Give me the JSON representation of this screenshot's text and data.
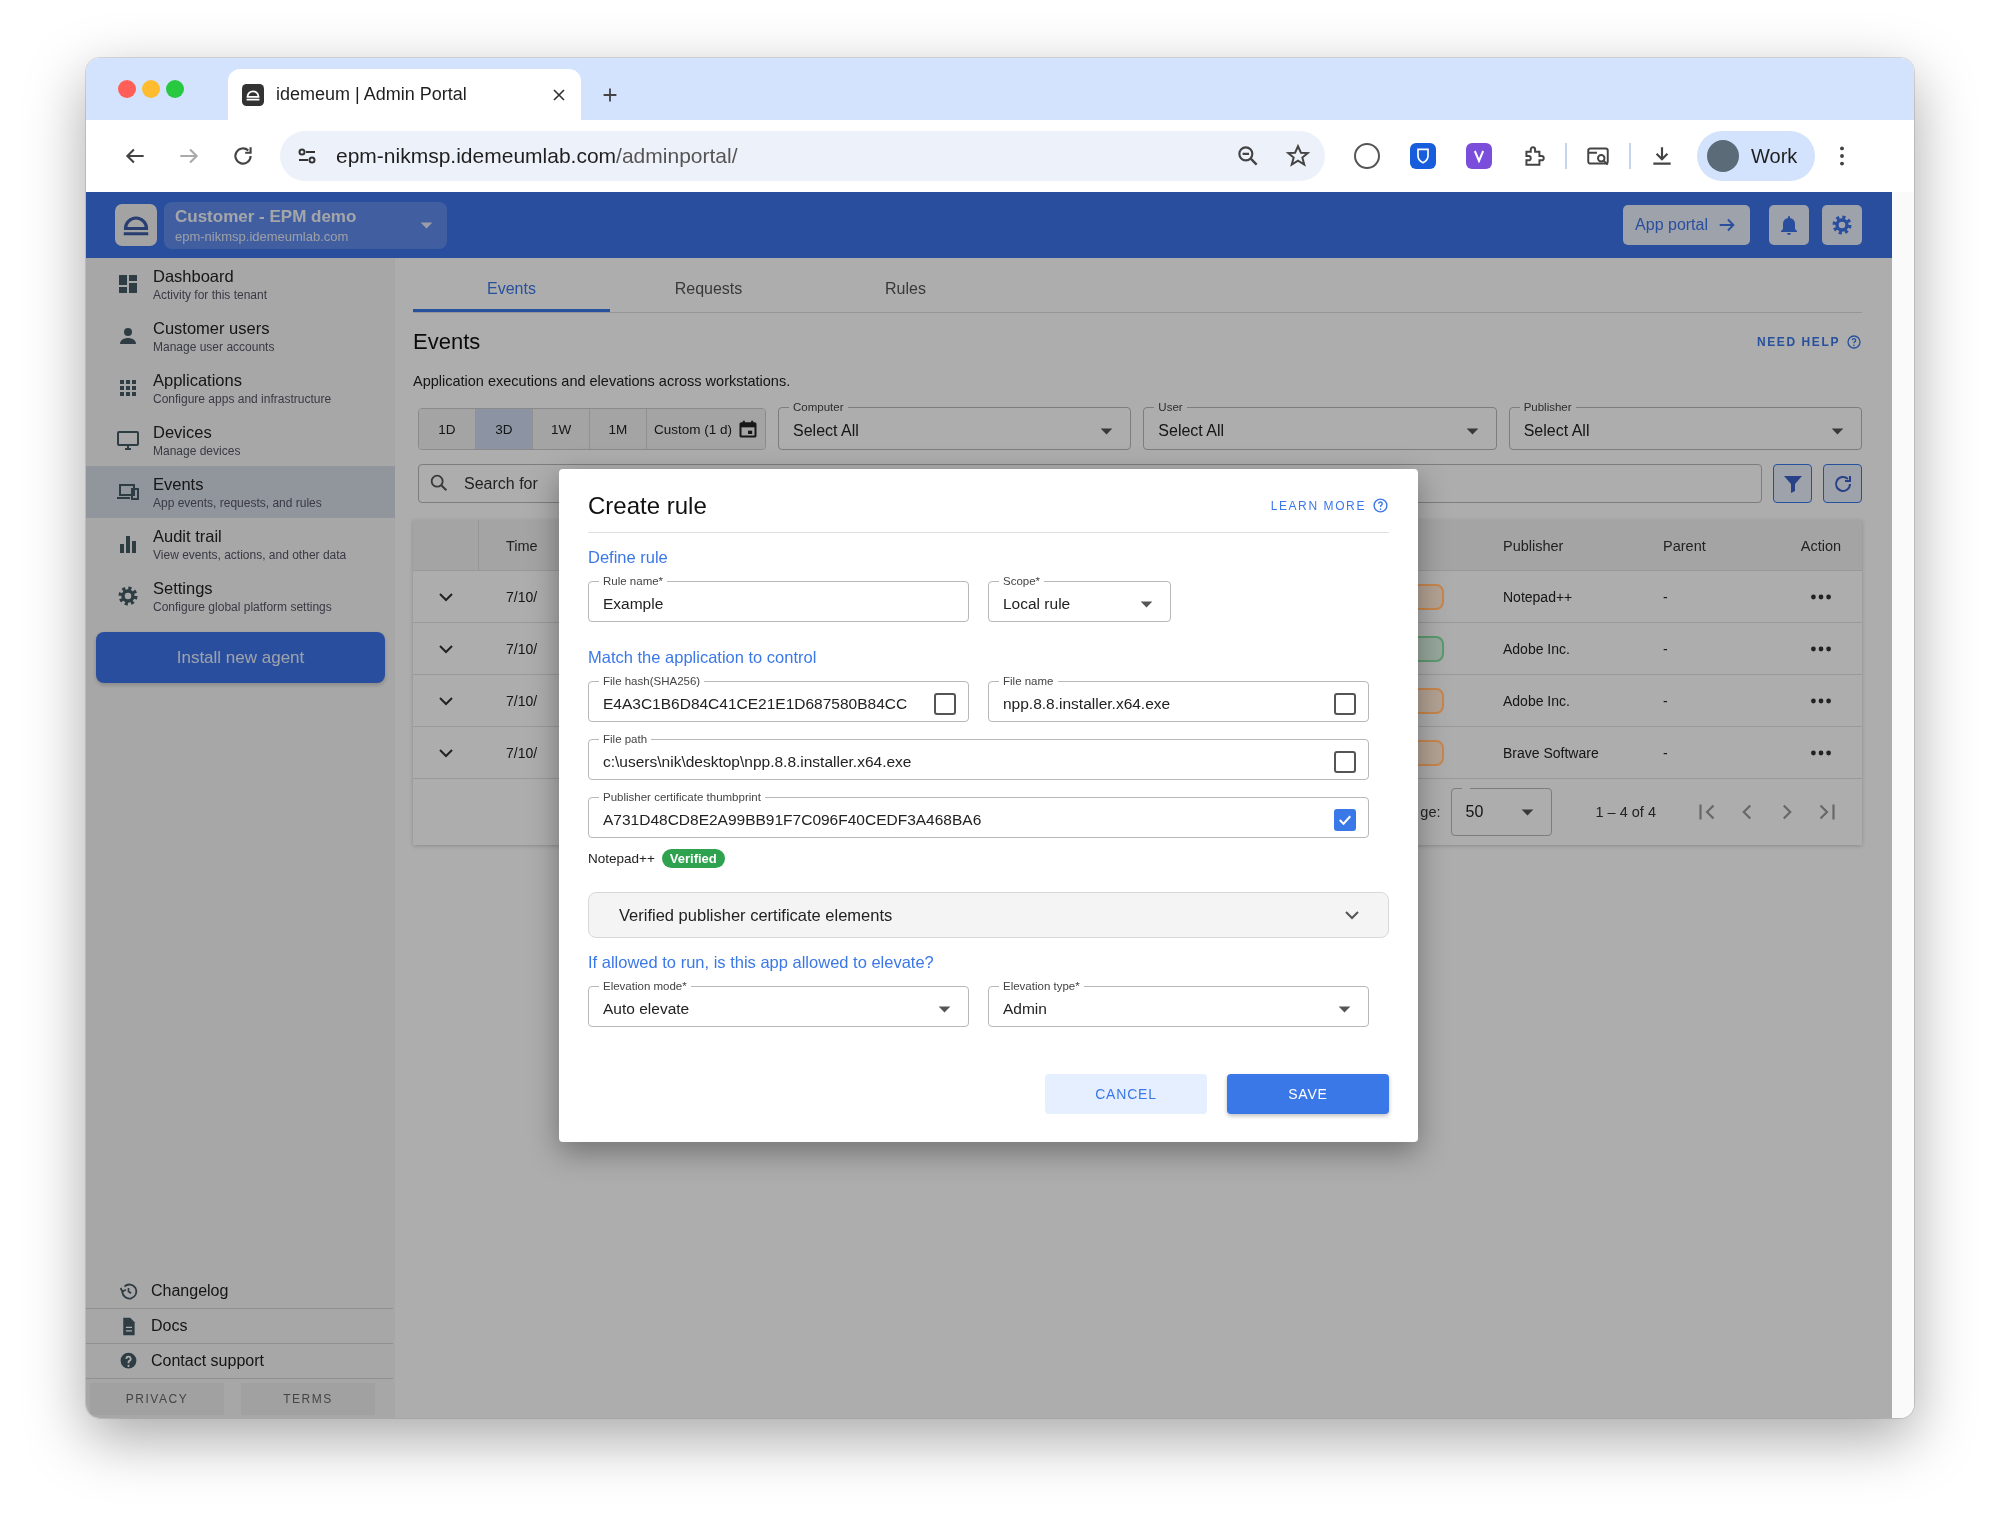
{
  "browser": {
    "tab_title": "idemeum | Admin Portal",
    "url_host": "epm-nikmsp.idemeumlab.com",
    "url_path": "/adminportal/",
    "profile": "Work"
  },
  "header": {
    "tenant_name": "Customer - EPM demo",
    "tenant_domain": "epm-nikmsp.idemeumlab.com",
    "app_portal": "App portal"
  },
  "sidebar": {
    "items": [
      {
        "title": "Dashboard",
        "subtitle": "Activity for this tenant",
        "selected": false
      },
      {
        "title": "Customer users",
        "subtitle": "Manage user accounts",
        "selected": false
      },
      {
        "title": "Applications",
        "subtitle": "Configure apps and infrastructure",
        "selected": false
      },
      {
        "title": "Devices",
        "subtitle": "Manage devices",
        "selected": false
      },
      {
        "title": "Events",
        "subtitle": "App events, requests, and rules",
        "selected": true
      },
      {
        "title": "Audit trail",
        "subtitle": "View events, actions, and other data",
        "selected": false
      },
      {
        "title": "Settings",
        "subtitle": "Configure global platform settings",
        "selected": false
      }
    ],
    "install_button": "Install new agent",
    "footer_links": [
      "Changelog",
      "Docs",
      "Contact support"
    ],
    "legal": [
      "PRIVACY",
      "TERMS"
    ]
  },
  "tabs": [
    {
      "label": "Events",
      "selected": true
    },
    {
      "label": "Requests",
      "selected": false
    },
    {
      "label": "Rules",
      "selected": false
    }
  ],
  "page": {
    "title": "Events",
    "need_help": "NEED HELP",
    "description": "Application executions and elevations across workstations."
  },
  "filters": {
    "periods": [
      {
        "label": "1D",
        "selected": false
      },
      {
        "label": "3D",
        "selected": true
      },
      {
        "label": "1W",
        "selected": false
      },
      {
        "label": "1M",
        "selected": false
      },
      {
        "label": "Custom (1 d)",
        "selected": false
      }
    ],
    "selects": [
      {
        "label": "Computer",
        "value": "Select All"
      },
      {
        "label": "User",
        "value": "Select All"
      },
      {
        "label": "Publisher",
        "value": "Select All"
      }
    ],
    "search_placeholder": "Search for"
  },
  "table": {
    "columns": {
      "time": "Time",
      "publisher": "Publisher",
      "parent": "Parent",
      "action": "Action"
    },
    "rows": [
      {
        "time": "7/10/",
        "color": "#c8864c",
        "publisher": "Notepad++",
        "parent": "-"
      },
      {
        "time": "7/10/",
        "color": "#5c9a6e",
        "publisher": "Adobe Inc.",
        "parent": "-"
      },
      {
        "time": "7/10/",
        "color": "#c8864c",
        "publisher": "Adobe Inc.",
        "parent": "-"
      },
      {
        "time": "7/10/",
        "color": "#c8864c",
        "publisher": "Brave Software",
        "parent": "-"
      }
    ],
    "pagination": {
      "per_page_label": "ge:",
      "per_page": "50",
      "range": "1 – 4 of 4"
    }
  },
  "dialog": {
    "title": "Create rule",
    "learn_more": "LEARN MORE",
    "define_heading": "Define rule",
    "rule_name": {
      "label": "Rule name*",
      "value": "Example"
    },
    "scope": {
      "label": "Scope*",
      "value": "Local rule"
    },
    "match_heading": "Match the application to control",
    "match_rows": [
      {
        "fields": [
          {
            "label": "File hash(SHA256)",
            "value": "E4A3C1B6D84C41CE21E1D687580B84CC",
            "checked": false
          },
          {
            "label": "File name",
            "value": "npp.8.8.installer.x64.exe",
            "checked": false
          }
        ]
      },
      {
        "fields": [
          {
            "label": "File path",
            "value": "c:\\users\\nik\\desktop\\npp.8.8.installer.x64.exe",
            "checked": false
          }
        ]
      },
      {
        "fields": [
          {
            "label": "Publisher certificate thumbprint",
            "value": "A731D48CD8E2A99BB91F7C096F40CEDF3A468BA6",
            "checked": true
          }
        ]
      }
    ],
    "publisher_note": "Notepad++",
    "verified_badge": "Verified",
    "accordion": {
      "label": "Verified publisher certificate elements",
      "expanded": false
    },
    "elevate_heading": "If allowed to run, is this app allowed to elevate?",
    "elevation_mode": {
      "label": "Elevation mode*",
      "value": "Auto elevate"
    },
    "elevation_type": {
      "label": "Elevation type*",
      "value": "Admin"
    },
    "buttons": [
      {
        "label": "CANCEL",
        "kind": "secondary"
      },
      {
        "label": "SAVE",
        "kind": "primary"
      }
    ]
  }
}
